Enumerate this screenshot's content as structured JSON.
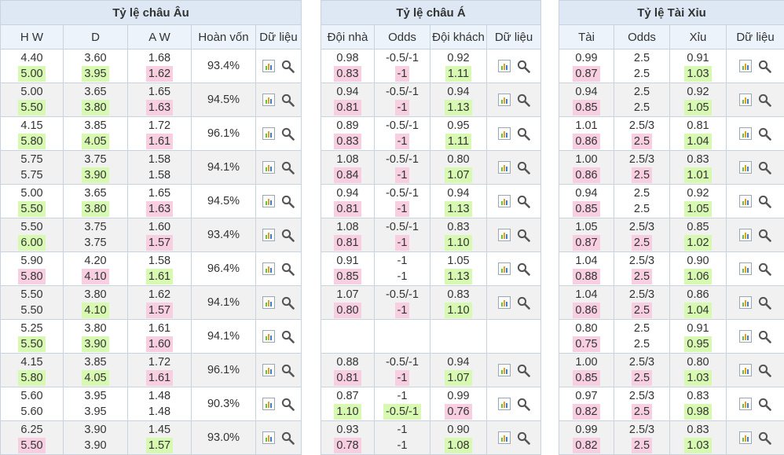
{
  "panels": [
    {
      "title": "Tỷ lệ châu Âu",
      "columns": [
        "H W",
        "D",
        "A W",
        "Hoàn vốn",
        "Dữ liệu"
      ],
      "rows": [
        {
          "cells": [
            [
              "4.40",
              "5.00"
            ],
            [
              "3.60",
              "3.95"
            ],
            [
              "1.68",
              "1.62"
            ]
          ],
          "hl": [
            [
              "",
              "g"
            ],
            [
              "",
              "g"
            ],
            [
              "",
              "p"
            ]
          ],
          "extra": "93.4%"
        },
        {
          "cells": [
            [
              "5.00",
              "5.50"
            ],
            [
              "3.65",
              "3.80"
            ],
            [
              "1.65",
              "1.63"
            ]
          ],
          "hl": [
            [
              "",
              "g"
            ],
            [
              "",
              "g"
            ],
            [
              "",
              "p"
            ]
          ],
          "extra": "94.5%"
        },
        {
          "cells": [
            [
              "4.15",
              "5.80"
            ],
            [
              "3.85",
              "4.05"
            ],
            [
              "1.72",
              "1.61"
            ]
          ],
          "hl": [
            [
              "",
              "g"
            ],
            [
              "",
              "g"
            ],
            [
              "",
              "p"
            ]
          ],
          "extra": "96.1%"
        },
        {
          "cells": [
            [
              "5.75",
              "5.75"
            ],
            [
              "3.75",
              "3.90"
            ],
            [
              "1.58",
              "1.58"
            ]
          ],
          "hl": [
            [
              "",
              ""
            ],
            [
              "",
              "g"
            ],
            [
              "",
              ""
            ]
          ],
          "extra": "94.1%"
        },
        {
          "cells": [
            [
              "5.00",
              "5.50"
            ],
            [
              "3.65",
              "3.80"
            ],
            [
              "1.65",
              "1.63"
            ]
          ],
          "hl": [
            [
              "",
              "g"
            ],
            [
              "",
              "g"
            ],
            [
              "",
              "p"
            ]
          ],
          "extra": "94.5%"
        },
        {
          "cells": [
            [
              "5.50",
              "6.00"
            ],
            [
              "3.75",
              "3.75"
            ],
            [
              "1.60",
              "1.57"
            ]
          ],
          "hl": [
            [
              "",
              "g"
            ],
            [
              "",
              ""
            ],
            [
              "",
              "p"
            ]
          ],
          "extra": "93.4%"
        },
        {
          "cells": [
            [
              "5.90",
              "5.80"
            ],
            [
              "4.20",
              "4.10"
            ],
            [
              "1.58",
              "1.61"
            ]
          ],
          "hl": [
            [
              "",
              "p"
            ],
            [
              "",
              "p"
            ],
            [
              "",
              "g"
            ]
          ],
          "extra": "96.4%"
        },
        {
          "cells": [
            [
              "5.50",
              "5.50"
            ],
            [
              "3.80",
              "4.10"
            ],
            [
              "1.62",
              "1.57"
            ]
          ],
          "hl": [
            [
              "",
              ""
            ],
            [
              "",
              "g"
            ],
            [
              "",
              "p"
            ]
          ],
          "extra": "94.1%"
        },
        {
          "cells": [
            [
              "5.25",
              "5.50"
            ],
            [
              "3.80",
              "3.90"
            ],
            [
              "1.61",
              "1.60"
            ]
          ],
          "hl": [
            [
              "",
              "g"
            ],
            [
              "",
              "g"
            ],
            [
              "",
              "p"
            ]
          ],
          "extra": "94.1%"
        },
        {
          "cells": [
            [
              "4.15",
              "5.80"
            ],
            [
              "3.85",
              "4.05"
            ],
            [
              "1.72",
              "1.61"
            ]
          ],
          "hl": [
            [
              "",
              "g"
            ],
            [
              "",
              "g"
            ],
            [
              "",
              "p"
            ]
          ],
          "extra": "96.1%"
        },
        {
          "cells": [
            [
              "5.60",
              "5.60"
            ],
            [
              "3.95",
              "3.95"
            ],
            [
              "1.48",
              "1.48"
            ]
          ],
          "hl": [
            [
              "",
              ""
            ],
            [
              "",
              ""
            ],
            [
              "",
              ""
            ]
          ],
          "extra": "90.3%"
        },
        {
          "cells": [
            [
              "6.25",
              "5.50"
            ],
            [
              "3.90",
              "3.90"
            ],
            [
              "1.45",
              "1.57"
            ]
          ],
          "hl": [
            [
              "",
              "p"
            ],
            [
              "",
              ""
            ],
            [
              "",
              "g"
            ]
          ],
          "extra": "93.0%"
        }
      ]
    },
    {
      "title": "Tỷ lệ châu Á",
      "columns": [
        "Đội nhà",
        "Odds",
        "Đội khách",
        "Dữ liệu"
      ],
      "rows": [
        {
          "cells": [
            [
              "0.98",
              "0.83"
            ],
            [
              "-0.5/-1",
              "-1"
            ],
            [
              "0.92",
              "1.11"
            ]
          ],
          "hl": [
            [
              "",
              "p"
            ],
            [
              "",
              "p"
            ],
            [
              "",
              "g"
            ]
          ]
        },
        {
          "cells": [
            [
              "0.94",
              "0.81"
            ],
            [
              "-0.5/-1",
              "-1"
            ],
            [
              "0.94",
              "1.13"
            ]
          ],
          "hl": [
            [
              "",
              "p"
            ],
            [
              "",
              "p"
            ],
            [
              "",
              "g"
            ]
          ]
        },
        {
          "cells": [
            [
              "0.89",
              "0.83"
            ],
            [
              "-0.5/-1",
              "-1"
            ],
            [
              "0.95",
              "1.11"
            ]
          ],
          "hl": [
            [
              "",
              "p"
            ],
            [
              "",
              "p"
            ],
            [
              "",
              "g"
            ]
          ]
        },
        {
          "cells": [
            [
              "1.08",
              "0.84"
            ],
            [
              "-0.5/-1",
              "-1"
            ],
            [
              "0.80",
              "1.07"
            ]
          ],
          "hl": [
            [
              "",
              "p"
            ],
            [
              "",
              "p"
            ],
            [
              "",
              "g"
            ]
          ]
        },
        {
          "cells": [
            [
              "0.94",
              "0.81"
            ],
            [
              "-0.5/-1",
              "-1"
            ],
            [
              "0.94",
              "1.13"
            ]
          ],
          "hl": [
            [
              "",
              "p"
            ],
            [
              "",
              "p"
            ],
            [
              "",
              "g"
            ]
          ]
        },
        {
          "cells": [
            [
              "1.08",
              "0.81"
            ],
            [
              "-0.5/-1",
              "-1"
            ],
            [
              "0.83",
              "1.10"
            ]
          ],
          "hl": [
            [
              "",
              "p"
            ],
            [
              "",
              "p"
            ],
            [
              "",
              "g"
            ]
          ]
        },
        {
          "cells": [
            [
              "0.91",
              "0.85"
            ],
            [
              "-1",
              "-1"
            ],
            [
              "1.05",
              "1.13"
            ]
          ],
          "hl": [
            [
              "",
              "p"
            ],
            [
              "",
              ""
            ],
            [
              "",
              "g"
            ]
          ]
        },
        {
          "cells": [
            [
              "1.07",
              "0.80"
            ],
            [
              "-0.5/-1",
              "-1"
            ],
            [
              "0.83",
              "1.10"
            ]
          ],
          "hl": [
            [
              "",
              "p"
            ],
            [
              "",
              "p"
            ],
            [
              "",
              "g"
            ]
          ]
        },
        {
          "empty": true
        },
        {
          "cells": [
            [
              "0.88",
              "0.81"
            ],
            [
              "-0.5/-1",
              "-1"
            ],
            [
              "0.94",
              "1.07"
            ]
          ],
          "hl": [
            [
              "",
              "p"
            ],
            [
              "",
              "p"
            ],
            [
              "",
              "g"
            ]
          ]
        },
        {
          "cells": [
            [
              "0.87",
              "1.10"
            ],
            [
              "-1",
              "-0.5/-1"
            ],
            [
              "0.99",
              "0.76"
            ]
          ],
          "hl": [
            [
              "",
              "g"
            ],
            [
              "",
              "g"
            ],
            [
              "",
              "p"
            ]
          ]
        },
        {
          "cells": [
            [
              "0.93",
              "0.78"
            ],
            [
              "-1",
              "-1"
            ],
            [
              "0.90",
              "1.08"
            ]
          ],
          "hl": [
            [
              "",
              "p"
            ],
            [
              "",
              ""
            ],
            [
              "",
              "g"
            ]
          ]
        }
      ]
    },
    {
      "title": "Tỷ lệ Tài Xỉu",
      "columns": [
        "Tài",
        "Odds",
        "Xỉu",
        "Dữ liệu"
      ],
      "rows": [
        {
          "cells": [
            [
              "0.99",
              "0.87"
            ],
            [
              "2.5",
              "2.5"
            ],
            [
              "0.91",
              "1.03"
            ]
          ],
          "hl": [
            [
              "",
              "p"
            ],
            [
              "",
              ""
            ],
            [
              "",
              "g"
            ]
          ]
        },
        {
          "cells": [
            [
              "0.94",
              "0.85"
            ],
            [
              "2.5",
              "2.5"
            ],
            [
              "0.92",
              "1.05"
            ]
          ],
          "hl": [
            [
              "",
              "p"
            ],
            [
              "",
              ""
            ],
            [
              "",
              "g"
            ]
          ]
        },
        {
          "cells": [
            [
              "1.01",
              "0.86"
            ],
            [
              "2.5/3",
              "2.5"
            ],
            [
              "0.81",
              "1.04"
            ]
          ],
          "hl": [
            [
              "",
              "p"
            ],
            [
              "",
              "p"
            ],
            [
              "",
              "g"
            ]
          ]
        },
        {
          "cells": [
            [
              "1.00",
              "0.86"
            ],
            [
              "2.5/3",
              "2.5"
            ],
            [
              "0.83",
              "1.01"
            ]
          ],
          "hl": [
            [
              "",
              "p"
            ],
            [
              "",
              "p"
            ],
            [
              "",
              "g"
            ]
          ]
        },
        {
          "cells": [
            [
              "0.94",
              "0.85"
            ],
            [
              "2.5",
              "2.5"
            ],
            [
              "0.92",
              "1.05"
            ]
          ],
          "hl": [
            [
              "",
              "p"
            ],
            [
              "",
              ""
            ],
            [
              "",
              "g"
            ]
          ]
        },
        {
          "cells": [
            [
              "1.05",
              "0.87"
            ],
            [
              "2.5/3",
              "2.5"
            ],
            [
              "0.85",
              "1.02"
            ]
          ],
          "hl": [
            [
              "",
              "p"
            ],
            [
              "",
              "p"
            ],
            [
              "",
              "g"
            ]
          ]
        },
        {
          "cells": [
            [
              "1.04",
              "0.88"
            ],
            [
              "2.5/3",
              "2.5"
            ],
            [
              "0.90",
              "1.06"
            ]
          ],
          "hl": [
            [
              "",
              "p"
            ],
            [
              "",
              "p"
            ],
            [
              "",
              "g"
            ]
          ]
        },
        {
          "cells": [
            [
              "1.04",
              "0.86"
            ],
            [
              "2.5/3",
              "2.5"
            ],
            [
              "0.86",
              "1.04"
            ]
          ],
          "hl": [
            [
              "",
              "p"
            ],
            [
              "",
              "p"
            ],
            [
              "",
              "g"
            ]
          ]
        },
        {
          "cells": [
            [
              "0.80",
              "0.75"
            ],
            [
              "2.5",
              "2.5"
            ],
            [
              "0.91",
              "0.95"
            ]
          ],
          "hl": [
            [
              "",
              "p"
            ],
            [
              "",
              ""
            ],
            [
              "",
              "g"
            ]
          ]
        },
        {
          "cells": [
            [
              "1.00",
              "0.85"
            ],
            [
              "2.5/3",
              "2.5"
            ],
            [
              "0.80",
              "1.03"
            ]
          ],
          "hl": [
            [
              "",
              "p"
            ],
            [
              "",
              "p"
            ],
            [
              "",
              "g"
            ]
          ]
        },
        {
          "cells": [
            [
              "0.97",
              "0.82"
            ],
            [
              "2.5/3",
              "2.5"
            ],
            [
              "0.83",
              "0.98"
            ]
          ],
          "hl": [
            [
              "",
              "p"
            ],
            [
              "",
              "p"
            ],
            [
              "",
              "g"
            ]
          ]
        },
        {
          "cells": [
            [
              "0.99",
              "0.82"
            ],
            [
              "2.5/3",
              "2.5"
            ],
            [
              "0.83",
              "1.03"
            ]
          ],
          "hl": [
            [
              "",
              "p"
            ],
            [
              "",
              "p"
            ],
            [
              "",
              "g"
            ]
          ]
        }
      ]
    }
  ],
  "icons": {
    "chart": "bar-chart-icon",
    "search": "magnifier-icon"
  },
  "colors": {
    "header_bg": "#dde8f4",
    "subheader_bg": "#edf3fa",
    "rise_green": "#d8f9b2",
    "drop_pink": "#f8cfe0",
    "alt_row": "#f1f1f1",
    "border": "#c9d3de"
  }
}
